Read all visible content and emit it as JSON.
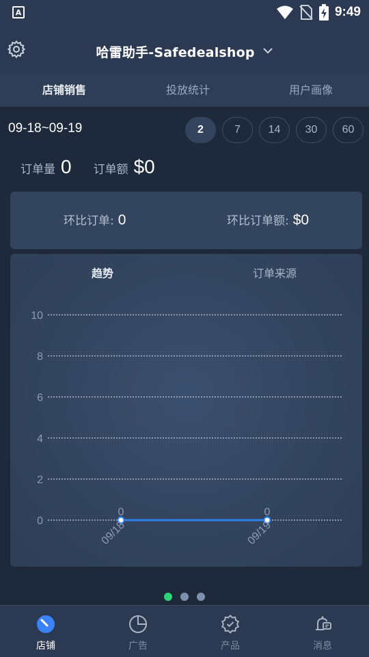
{
  "status_bar": {
    "time": "9:49",
    "icons": [
      "notification-a-icon",
      "wifi-icon",
      "no-sim-icon",
      "battery-charging-icon"
    ]
  },
  "header": {
    "shop_title": "哈雷助手-Safedealshop",
    "tabs": [
      {
        "label": "店铺销售",
        "active": true
      },
      {
        "label": "投放统计",
        "active": false
      },
      {
        "label": "用户画像",
        "active": false
      }
    ]
  },
  "summary": {
    "date_range": "09-18~09-19",
    "range_options": [
      "2",
      "7",
      "14",
      "30",
      "60"
    ],
    "selected_range": "2",
    "order_count_label": "订单量",
    "order_count": "0",
    "order_amount_label": "订单额",
    "order_amount": "$0"
  },
  "comparison": {
    "orders_label": "环比订单:",
    "orders_value": "0",
    "amount_label": "环比订单额:",
    "amount_value": "$0"
  },
  "chart": {
    "tabs": [
      {
        "label": "趋势",
        "active": true
      },
      {
        "label": "订单来源",
        "active": false
      }
    ]
  },
  "chart_data": {
    "type": "line",
    "categories": [
      "09/18",
      "09/19"
    ],
    "values": [
      0,
      0
    ],
    "data_labels": [
      "0",
      "0"
    ],
    "y_ticks": [
      "0",
      "2",
      "4",
      "6",
      "8",
      "10"
    ],
    "ylim": [
      0,
      10
    ],
    "grid": true,
    "line_color": "#2f80ed"
  },
  "pager": {
    "count": 3,
    "active": 0
  },
  "bottom_nav": [
    {
      "label": "店铺",
      "icon": "dashboard-icon",
      "active": true
    },
    {
      "label": "广告",
      "icon": "pie-chart-icon",
      "active": false
    },
    {
      "label": "产品",
      "icon": "badge-check-icon",
      "active": false
    },
    {
      "label": "消息",
      "icon": "message-bell-icon",
      "active": false
    }
  ],
  "colors": {
    "background": "#1e2a3b",
    "header": "#2b3a52",
    "card": "#33445e",
    "accent_green": "#2ed47a",
    "accent_blue": "#2f80ed"
  }
}
